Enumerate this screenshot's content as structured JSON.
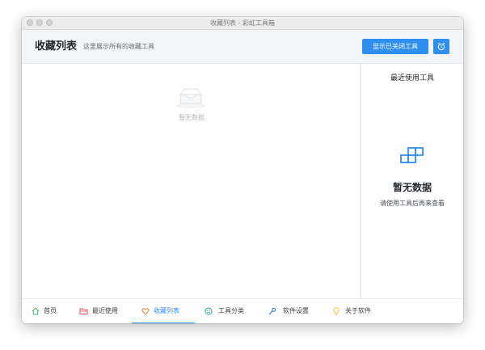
{
  "window": {
    "title": "收藏列表 - 彩虹工具箱"
  },
  "header": {
    "title": "收藏列表",
    "subtitle": "这里展示所有的收藏工具",
    "show_closed_label": "显示已关闭工具"
  },
  "main": {
    "empty_text": "暂无数据"
  },
  "recent": {
    "title": "最近使用工具",
    "empty_title": "暂无数据",
    "empty_desc": "请使用工具后再来查看"
  },
  "nav": {
    "items": [
      {
        "label": "首页",
        "icon": "home-icon"
      },
      {
        "label": "最近使用",
        "icon": "folder-icon"
      },
      {
        "label": "收藏列表",
        "icon": "heart-icon",
        "active": true
      },
      {
        "label": "工具分类",
        "icon": "category-icon"
      },
      {
        "label": "软件设置",
        "icon": "wrench-icon"
      },
      {
        "label": "关于软件",
        "icon": "bulb-icon"
      }
    ]
  },
  "colors": {
    "accent": "#2e8ff0",
    "home": "#3bb36b",
    "recent": "#e8545a",
    "favorite": "#e8822e",
    "category": "#2fa89a",
    "settings": "#4a78c8",
    "about": "#e6c83a"
  }
}
